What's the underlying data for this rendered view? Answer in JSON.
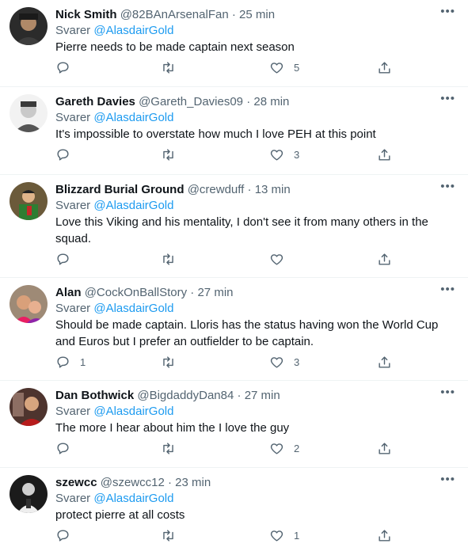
{
  "reply_prefix": "Svarer",
  "tweets": [
    {
      "name": "Nick Smith",
      "handle": "@82BAnArsenalFan",
      "time": "25 min",
      "replying_to": "@AlasdairGold",
      "text": "Pierre needs to be made captain next season",
      "replies": "",
      "retweets": "",
      "likes": "5"
    },
    {
      "name": "Gareth Davies",
      "handle": "@Gareth_Davies09",
      "time": "28 min",
      "replying_to": "@AlasdairGold",
      "text": "It's impossible to overstate how much I love PEH at this point",
      "replies": "",
      "retweets": "",
      "likes": "3"
    },
    {
      "name": "Blizzard Burial Ground",
      "handle": "@crewduff",
      "time": "13 min",
      "replying_to": "@AlasdairGold",
      "text": "Love this Viking and his mentality, I don't see it from many others in the squad.",
      "replies": "",
      "retweets": "",
      "likes": ""
    },
    {
      "name": "Alan",
      "handle": "@CockOnBallStory",
      "time": "27 min",
      "replying_to": "@AlasdairGold",
      "text": "Should be made captain. Lloris has the status having won the World Cup and Euros but I prefer an outfielder to be captain.",
      "replies": "1",
      "retweets": "",
      "likes": "3"
    },
    {
      "name": "Dan Bothwick",
      "handle": "@BigdaddyDan84",
      "time": "27 min",
      "replying_to": "@AlasdairGold",
      "text": "The more I hear about him the I love the guy",
      "replies": "",
      "retweets": "",
      "likes": "2"
    },
    {
      "name": "szewcc",
      "handle": "@szewcc12",
      "time": "23 min",
      "replying_to": "@AlasdairGold",
      "text": "protect pierre at all costs",
      "replies": "",
      "retweets": "",
      "likes": "1"
    }
  ],
  "colors": {
    "accent": "#1d9bf0",
    "muted": "#536471",
    "text": "#0f1419",
    "divider": "#eff3f4"
  },
  "icons": {
    "reply": "speech-bubble-icon",
    "retweet": "retweet-arrows-icon",
    "like": "heart-icon",
    "share": "share-upload-icon",
    "more": "ellipsis-icon"
  }
}
